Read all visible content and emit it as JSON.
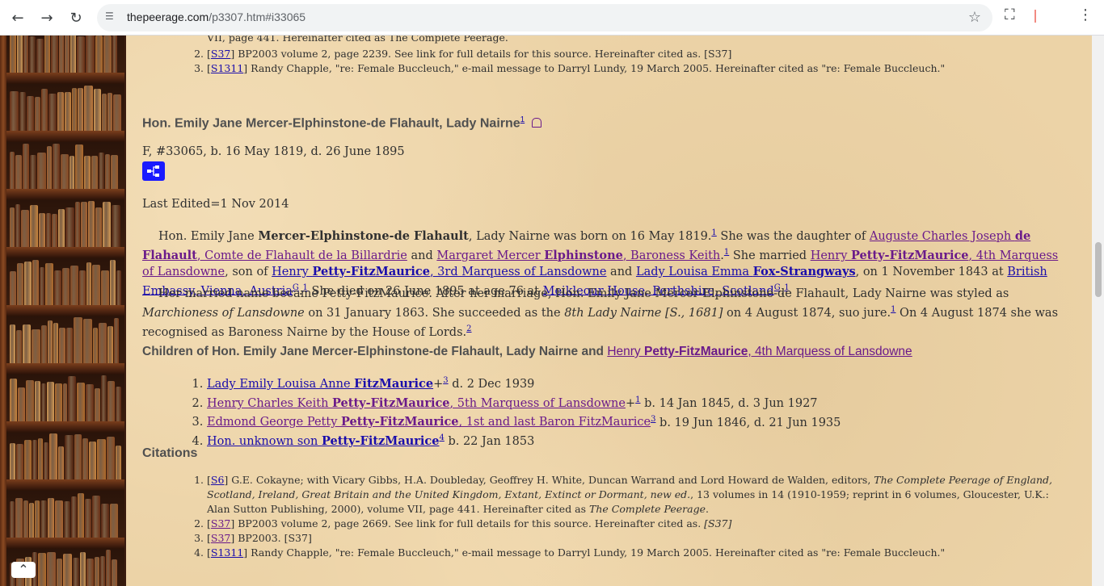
{
  "browser": {
    "url_host": "thepeerage.com",
    "url_path": "/p3307.htm#i33065",
    "back_icon": "arrow-left-icon",
    "forward_icon": "arrow-right-icon",
    "reload_icon": "reload-icon",
    "site_info_icon": "tune-icon",
    "bookmark_icon": "star-icon",
    "extensions_icon": "puzzle-icon",
    "menu_icon": "kebab-menu-icon"
  },
  "top_citations": {
    "partial_line": "VII, page 441. Hereinafter cited as The Complete Peerage.",
    "items": [
      {
        "num": "2.",
        "tag": "S37",
        "text": " BP2003 volume 2, page 2239. See link for full details for this source. Hereinafter cited as. [S37]"
      },
      {
        "num": "3.",
        "tag": "S1311",
        "text": " Randy Chapple, \"re: Female Buccleuch,\" e-mail message to Darryl Lundy, 19 March 2005. Hereinafter cited as \"re: Female Buccleuch.\""
      }
    ]
  },
  "person": {
    "title": "Hon. Emily Jane Mercer-Elphinstone-de Flahault, Lady Nairne",
    "title_sup": "1",
    "info": "F, #33065, b. 16 May 1819, d. 26 June 1895",
    "last_edited": "Last Edited=1 Nov 2014"
  },
  "bio": {
    "p1_a": "Hon. Emily Jane ",
    "p1_b": "Mercer-Elphinstone-de Flahault",
    "p1_c": ", Lady Nairne was born on 16 May 1819.",
    "p1_d": " She was the daughter of ",
    "father_a": "Auguste Charles Joseph ",
    "father_b": "de Flahault",
    "father_c": ", Comte de Flahault de la Billardrie",
    "and1": " and ",
    "mother_a": "Margaret Mercer ",
    "mother_b": "Elphinstone",
    "mother_c": ", Baroness Keith",
    "p1_e": ". ",
    "married": " She married ",
    "husband_a": "Henry ",
    "husband_b": "Petty-FitzMaurice",
    "husband_c": ", 4th Marquess of Lansdowne",
    "sonof": ", son of ",
    "hf_a": "Henry ",
    "hf_b": "Petty-FitzMaurice",
    "hf_c": ", 3rd Marquess of Lansdowne",
    "and2": " and ",
    "hm_a": "Lady Louisa Emma ",
    "hm_b": "Fox-Strangways",
    "on_date": ", on 1 November 1843 at ",
    "place1": "British Embassy, Vienna, Austria",
    "g": "G",
    "died": " She died on 26 June 1895 at age 76 at ",
    "place2": "Meikleour House, Perthshire, Scotland",
    "p2_a": "Her married name became Petty-FitzMaurice. After her marriage, Hon. Emily Jane Mercer-Elphinstone-de Flahault, Lady Nairne was styled as ",
    "p2_b": "Marchioness of Lansdowne",
    "p2_c": " on 31 January 1863. She succeeded as the ",
    "p2_d": "8th Lady Nairne [S., 1681]",
    "p2_e": " on 4 August 1874, suo jure.",
    "p2_f": " On 4 August 1874 she was recognised as Baroness Nairne by the House of Lords.",
    "s1": "1",
    "s2": "2"
  },
  "children_heading": {
    "prefix": "Children of Hon. Emily Jane Mercer-Elphinstone-de Flahault, Lady Nairne and ",
    "link_a": "Henry ",
    "link_b": "Petty-FitzMaurice",
    "link_c": ", 4th Marquess of Lansdowne"
  },
  "children": [
    {
      "a": "Lady Emily Louisa Anne ",
      "b": "FitzMaurice",
      "c": "",
      "plus": "+",
      "sup": "3",
      "tail": " d. 2 Dec 1939"
    },
    {
      "a": "Henry Charles Keith ",
      "b": "Petty-FitzMaurice",
      "c": ", 5th Marquess of Lansdowne",
      "plus": "+",
      "sup": "1",
      "tail": " b. 14 Jan 1845, d. 3 Jun 1927"
    },
    {
      "a": "Edmond George Petty ",
      "b": "Petty-FitzMaurice",
      "c": ", 1st and last Baron FitzMaurice",
      "plus": "",
      "sup": "3",
      "tail": " b. 19 Jun 1846, d. 21 Jun 1935"
    },
    {
      "a": "Hon. unknown son ",
      "b": "Petty-FitzMaurice",
      "c": "",
      "plus": "",
      "sup": "4",
      "tail": " b. 22 Jan 1853"
    }
  ],
  "citations_heading": "Citations",
  "citations": [
    {
      "tag": "S6",
      "text_a": " G.E. Cokayne; with Vicary Gibbs, H.A. Doubleday, Geoffrey H. White, Duncan Warrand and Lord Howard de Walden, editors, ",
      "text_i": "The Complete Peerage of England, Scotland, Ireland, Great Britain and the United Kingdom, Extant, Extinct or Dormant, new ed.",
      "text_b": ", 13 volumes in 14 (1910-1959; reprint in 6 volumes, Gloucester, U.K.: Alan Sutton Publishing, 2000), volume VII, page 441. Hereinafter cited as ",
      "text_i2": "The Complete Peerage",
      "text_c": "."
    },
    {
      "tag": "S37",
      "text_a": " BP2003 volume 2, page 2669. See link for full details for this source. Hereinafter cited as. ",
      "text_i": "[S37]",
      "text_b": "",
      "text_i2": "",
      "text_c": ""
    },
    {
      "tag": "S37",
      "text_a": " BP2003. [S37]",
      "text_i": "",
      "text_b": "",
      "text_i2": "",
      "text_c": ""
    },
    {
      "tag": "S1311",
      "text_a": " Randy Chapple, \"re: Female Buccleuch,\" e-mail message to Darryl Lundy, 19 March 2005. Hereinafter cited as \"re: Female Buccleuch.\"",
      "text_i": "",
      "text_b": "",
      "text_i2": "",
      "text_c": ""
    }
  ],
  "colors": {
    "parchment": "#ecd3a7",
    "link": "#1a0dab",
    "visited": "#6a1a8a",
    "tree_button": "#1a1aff"
  }
}
